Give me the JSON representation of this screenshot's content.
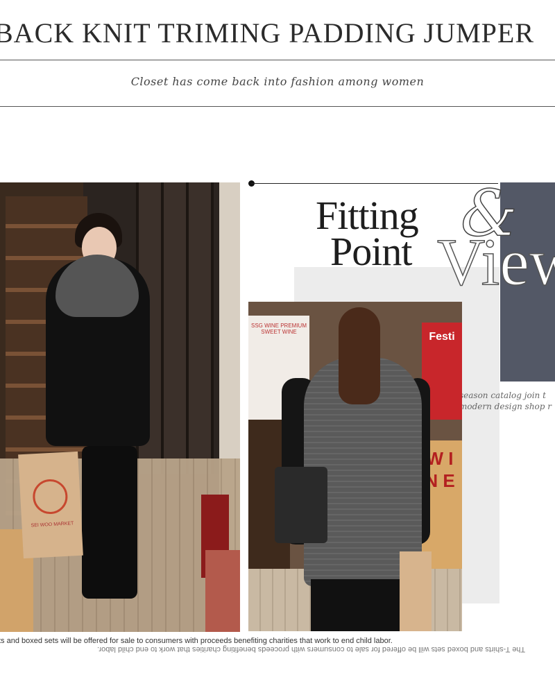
{
  "header": {
    "title": "BACK KNIT TRIMING PADDING JUMPER",
    "subtitle": "Closet has come back into fashion among women"
  },
  "feature": {
    "line1": "Fitting",
    "line2": "Point",
    "amp": "&",
    "view": "View",
    "script_text": "season catalog join t\nmodern design shop r"
  },
  "photo1": {
    "bag_text": "SEI WOO MARKET"
  },
  "photo2": {
    "sign_text": "SSG WINE PREMIUM SWEET WINE",
    "red_sign": "Festi",
    "crate_text": "W I N E"
  },
  "footer": {
    "line": "ts and boxed sets will be offered for sale to consumers with proceeds benefiting charities that work to end child labor.",
    "mirrored": "The T-shirts and boxed sets will be offered for sale to consumers with proceeds benefiting charities that work to end child labor."
  }
}
